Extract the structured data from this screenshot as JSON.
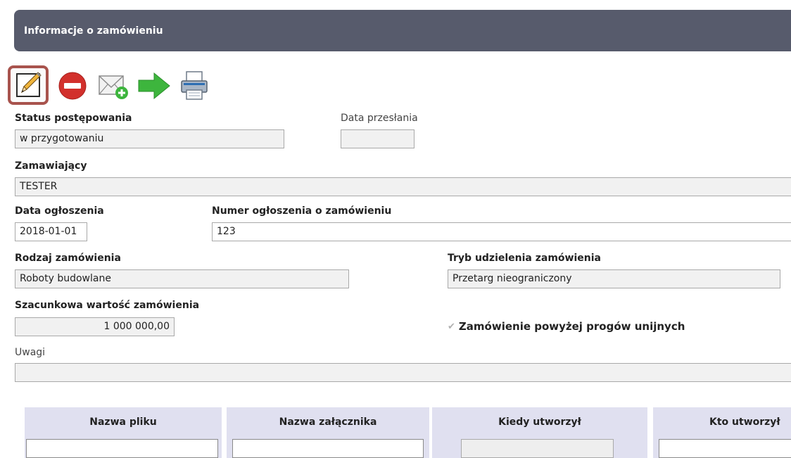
{
  "header": {
    "title": "Informacje o zamówieniu"
  },
  "toolbar": {
    "buttons": [
      {
        "icon": "pencil-icon"
      },
      {
        "icon": "delete-icon"
      },
      {
        "icon": "mail-add-icon"
      },
      {
        "icon": "arrow-right-icon"
      },
      {
        "icon": "printer-icon"
      }
    ]
  },
  "form": {
    "status_label": "Status postępowania",
    "status_value": "w przygotowaniu",
    "sent_date_label": "Data przesłania",
    "sent_date_value": "",
    "buyer_label": "Zamawiający",
    "buyer_value": "TESTER",
    "announce_date_label": "Data ogłoszenia",
    "announce_date_value": "2018-01-01",
    "announce_number_label": "Numer ogłoszenia o zamówieniu",
    "announce_number_value": "123",
    "order_type_label": "Rodzaj zamówienia",
    "order_type_value": "Roboty budowlane",
    "procedure_label": "Tryb udzielenia zamówienia",
    "procedure_value": "Przetarg nieograniczony",
    "estimated_value_label": "Szacunkowa wartość zamówienia",
    "estimated_value_value": "1 000 000,00",
    "eu_threshold_label": "Zamówienie powyżej progów unijnych",
    "eu_threshold_checked": true,
    "notes_label": "Uwagi",
    "notes_value": ""
  },
  "attachments_table": {
    "columns": [
      {
        "title": "Nazwa pliku"
      },
      {
        "title": "Nazwa załącznika"
      },
      {
        "title": "Kiedy utworzył"
      },
      {
        "title": "Kto utworzył"
      }
    ]
  },
  "colors": {
    "header_bg": "#575b6c",
    "edit_border": "#a8534d",
    "delete_red": "#d2302c",
    "arrow_green": "#3db53d",
    "table_header_bg": "#e0e0f0"
  }
}
